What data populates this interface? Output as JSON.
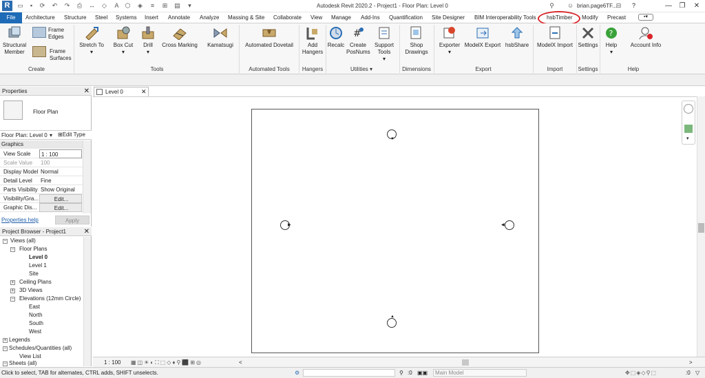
{
  "app": {
    "logo_letter": "R",
    "title": "Autodesk Revit 2020.2 - Project1 - Floor Plan: Level 0",
    "user": "brian.page6TF...",
    "help_q": "?",
    "win_min": "—",
    "win_restore": "❐",
    "win_close": "✕"
  },
  "tabs": {
    "file": "File",
    "architecture": "Architecture",
    "structure": "Structure",
    "steel": "Steel",
    "systems": "Systems",
    "insert": "Insert",
    "annotate": "Annotate",
    "analyze": "Analyze",
    "massing": "Massing & Site",
    "collaborate": "Collaborate",
    "view": "View",
    "manage": "Manage",
    "addins": "Add-Ins",
    "quantification": "Quantification",
    "site_designer": "Site Designer",
    "bim_interop": "BIM Interoperability Tools",
    "hsbtimber": "hsbTimber",
    "modify": "Modify",
    "precast": "Precast"
  },
  "ribbon": {
    "structural_member": "Structural Member",
    "frame_edges": "Frame Edges",
    "frame_surfaces": "Frame Surfaces",
    "stretch_to": "Stretch To",
    "box_cut": "Box Cut",
    "drill": "Drill",
    "cross_marking": "Cross Marking",
    "kamatsugi": "Kamatsugi",
    "automated_dovetail": "Automated Dovetail",
    "add_hangers": "Add Hangers",
    "recalc": "Recalc",
    "create_posnums": "Create PosNums",
    "support_tools": "Support Tools",
    "shop_drawings": "Shop Drawings",
    "exporter": "Exporter",
    "modelx_export": "ModelX Export",
    "hsbshare": "hsbShare",
    "modelx_import": "ModelX Import",
    "settings": "Settings",
    "help": "Help",
    "account_info": "Account Info",
    "panels": {
      "create": "Create",
      "tools": "Tools",
      "automated_tools": "Automated Tools",
      "hangers": "Hangers",
      "utilities": "Utilities",
      "dimensions": "Dimensions",
      "export": "Export",
      "import": "Import",
      "settings": "Settings",
      "help": "Help"
    }
  },
  "properties": {
    "title": "Properties",
    "type_name": "Floor Plan",
    "selector": "Floor Plan: Level 0",
    "edit_type": "Edit Type",
    "section": "Graphics",
    "rows": [
      {
        "k": "View Scale",
        "v": "1 : 100"
      },
      {
        "k": "Scale Value",
        "v": "100"
      },
      {
        "k": "Display Model",
        "v": "Normal"
      },
      {
        "k": "Detail Level",
        "v": "Fine"
      },
      {
        "k": "Parts Visibility",
        "v": "Show Original"
      },
      {
        "k": "Visibility/Gra...",
        "v": "Edit..."
      },
      {
        "k": "Graphic Dis...",
        "v": "Edit..."
      }
    ],
    "help_link": "Properties help",
    "apply": "Apply"
  },
  "browser": {
    "title": "Project Browser - Project1",
    "views": "Views (all)",
    "floor_plans": "Floor Plans",
    "level0": "Level 0",
    "level1": "Level 1",
    "site": "Site",
    "ceiling_plans": "Ceiling Plans",
    "views3d": "3D Views",
    "elevations": "Elevations (12mm Circle)",
    "east": "East",
    "north": "North",
    "south": "South",
    "west": "West",
    "legends": "Legends",
    "schedules": "Schedules/Quantities (all)",
    "view_list": "View List",
    "sheets": "Sheets (all)"
  },
  "view": {
    "tab_label": "Level 0",
    "scale": "1 : 100"
  },
  "status": {
    "hint": "Click to select, TAB for alternates, CTRL adds, SHIFT unselects.",
    "filter_count": ":0",
    "workset": "Main Model",
    "right_count": ":0"
  },
  "colors": {
    "file_tab": "#1e6bb8",
    "highlight_ring": "#d9252a"
  }
}
